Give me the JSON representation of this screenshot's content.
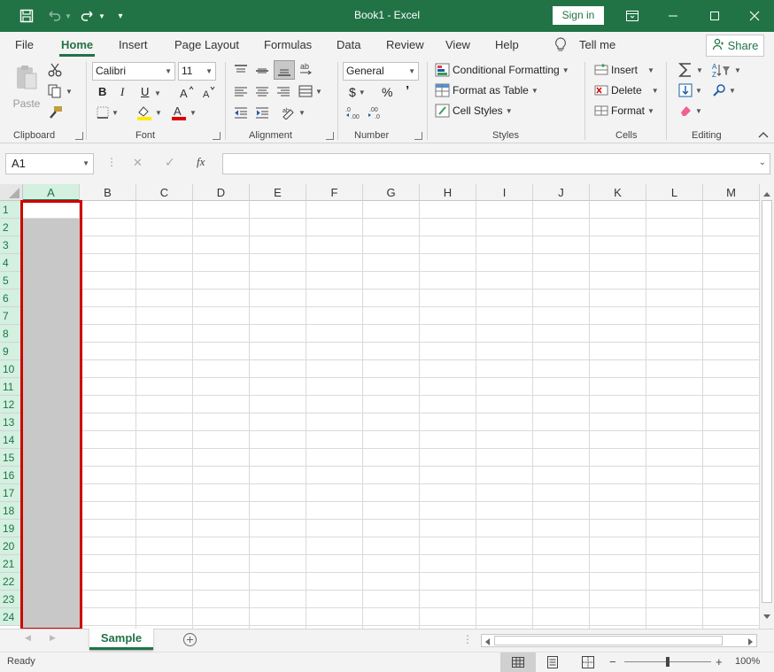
{
  "window": {
    "title": "Book1 - Excel",
    "sign_in": "Sign in"
  },
  "tabs": [
    "File",
    "Home",
    "Insert",
    "Page Layout",
    "Formulas",
    "Data",
    "Review",
    "View",
    "Help"
  ],
  "tell_me": "Tell me",
  "share": "Share",
  "ribbon": {
    "clipboard": {
      "label": "Clipboard",
      "paste": "Paste"
    },
    "font": {
      "label": "Font",
      "family": "Calibri",
      "size": "11",
      "bold": "B",
      "italic": "I",
      "underline": "U"
    },
    "alignment": {
      "label": "Alignment"
    },
    "number": {
      "label": "Number",
      "format": "General",
      "currency": "$",
      "percent": "%",
      "comma": "’"
    },
    "styles": {
      "label": "Styles",
      "conditional": "Conditional Formatting",
      "format_table": "Format as Table",
      "cell_styles": "Cell Styles"
    },
    "cells": {
      "label": "Cells",
      "insert": "Insert",
      "delete": "Delete",
      "format": "Format"
    },
    "editing": {
      "label": "Editing"
    }
  },
  "formula_bar": {
    "name_box": "A1",
    "fx": "fx",
    "cancel": "✕",
    "enter": "✓"
  },
  "columns": [
    "A",
    "B",
    "C",
    "D",
    "E",
    "F",
    "G",
    "H",
    "I",
    "J",
    "K",
    "L",
    "M"
  ],
  "rows": [
    "1",
    "2",
    "3",
    "4",
    "5",
    "6",
    "7",
    "8",
    "9",
    "10",
    "11",
    "12",
    "13",
    "14",
    "15",
    "16",
    "17",
    "18",
    "19",
    "20",
    "21",
    "22",
    "23",
    "24"
  ],
  "sheet": {
    "name": "Sample"
  },
  "status": {
    "ready": "Ready",
    "zoom": "100%",
    "minus": "−",
    "plus": "+"
  },
  "colors": {
    "accent": "#217346",
    "highlight": "#d00000"
  }
}
